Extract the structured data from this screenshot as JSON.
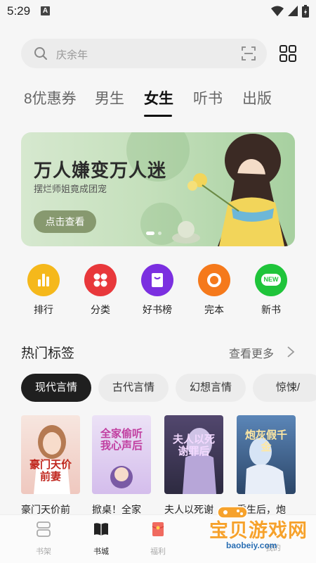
{
  "status_bar": {
    "time": "5:29",
    "notification_letter": "A"
  },
  "search": {
    "placeholder": "庆余年"
  },
  "tabs": [
    {
      "label": "8优惠券",
      "active": false
    },
    {
      "label": "男生",
      "active": false
    },
    {
      "label": "女生",
      "active": true
    },
    {
      "label": "听书",
      "active": false
    },
    {
      "label": "出版",
      "active": false
    }
  ],
  "banner": {
    "title": "万人嫌变万人迷",
    "subtitle": "摆烂师姐竟成团宠",
    "button_label": "点击查看"
  },
  "quick_entries": [
    {
      "label": "排行",
      "color": "#f5b81b",
      "icon": "bar-chart-icon"
    },
    {
      "label": "分类",
      "color": "#e8383b",
      "icon": "four-dots-icon"
    },
    {
      "label": "好书榜",
      "color": "#7b2fe0",
      "icon": "bookmark-icon"
    },
    {
      "label": "完本",
      "color": "#f5791b",
      "icon": "ring-icon"
    },
    {
      "label": "新书",
      "color": "#1fc43a",
      "icon": "new-badge-icon",
      "badge": "NEW"
    }
  ],
  "hot_tags": {
    "title": "热门标签",
    "more_label": "查看更多",
    "chips": [
      {
        "label": "现代言情",
        "active": true
      },
      {
        "label": "古代言情",
        "active": false
      },
      {
        "label": "幻想言情",
        "active": false
      },
      {
        "label": "惊悚/",
        "active": false
      }
    ]
  },
  "books": [
    {
      "title": "豪门天价前",
      "cover_text": "豪门天价前妻",
      "cover_color": "#f3d9d2"
    },
    {
      "title": "掀桌！全家",
      "cover_text": "全家偷听我心声后",
      "cover_color": "#d9c7ee"
    },
    {
      "title": "夫人以死谢",
      "cover_text": "夫人以死谢罪后",
      "cover_color": "#3a3550"
    },
    {
      "title": "重生后，炮",
      "cover_text": "炮灰假千金",
      "cover_color": "#3f5f8d"
    }
  ],
  "bottom_nav": [
    {
      "label": "书架",
      "active": false
    },
    {
      "label": "书城",
      "active": true
    },
    {
      "label": "福利",
      "active": false
    },
    {
      "label": "",
      "active": false
    },
    {
      "label": "我的",
      "active": false
    }
  ],
  "watermark": {
    "text": "宝贝游戏网",
    "url": "baobeiy.com"
  }
}
